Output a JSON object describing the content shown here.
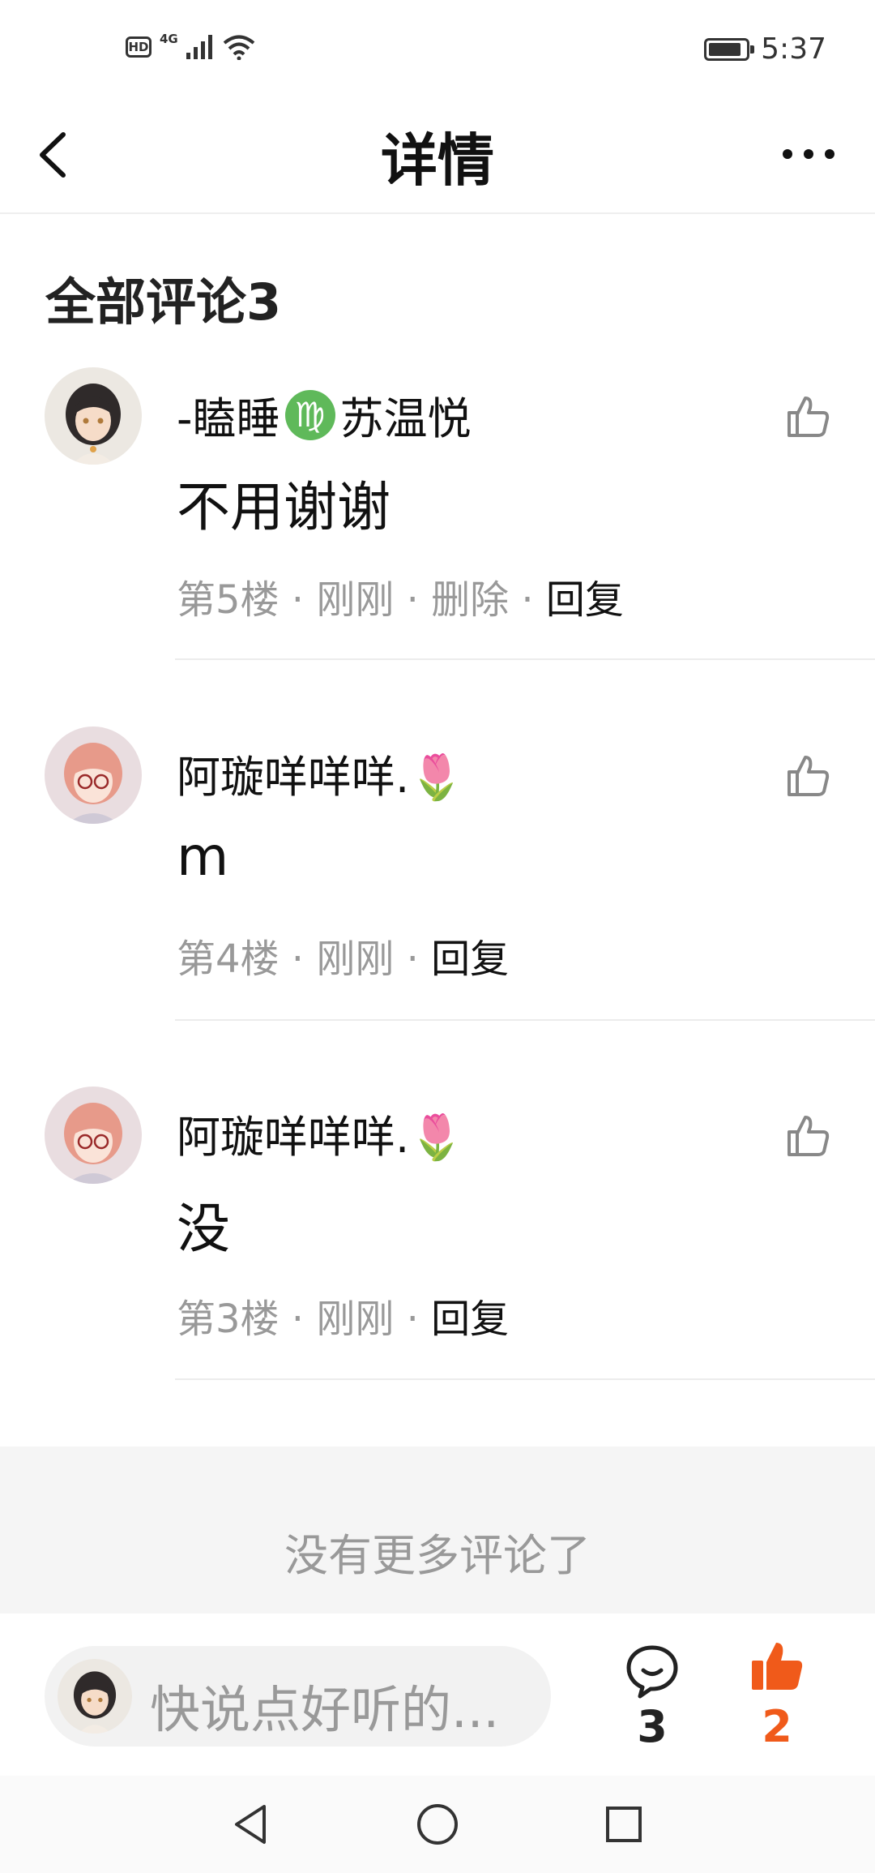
{
  "status_bar": {
    "hd": "HD",
    "network": "4G",
    "time": "5:37"
  },
  "header": {
    "title": "详情"
  },
  "comments_section": {
    "title": "全部评论3",
    "comments": [
      {
        "user_prefix": "-瞌睡",
        "zodiac_symbol": "♍",
        "user_suffix": "苏温悦",
        "text": "不用谢谢",
        "floor": "第5楼",
        "time": "刚刚",
        "delete": "删除",
        "reply": "回复",
        "sep": " · "
      },
      {
        "username": "阿璇咩咩咩.🌷",
        "text": "m",
        "floor": "第4楼",
        "time": "刚刚",
        "reply": "回复",
        "sep": " · "
      },
      {
        "username": "阿璇咩咩咩.🌷",
        "text": "没",
        "floor": "第3楼",
        "time": "刚刚",
        "reply": "回复",
        "sep": " · "
      }
    ],
    "no_more": "没有更多评论了"
  },
  "bottom_bar": {
    "input_placeholder": "快说点好听的...",
    "comment_count": "3",
    "like_count": "2"
  },
  "colors": {
    "accent": "#f05a1a",
    "zodiac": "#5fb95a",
    "muted": "#999999"
  }
}
